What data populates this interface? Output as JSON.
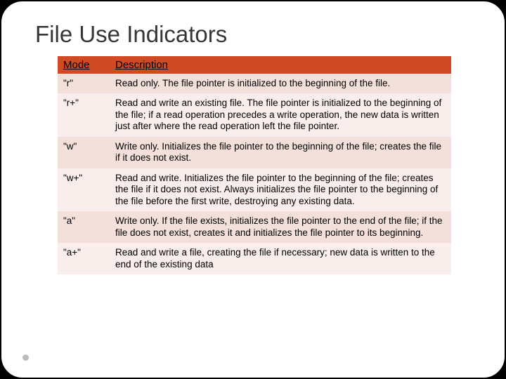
{
  "title": "File Use Indicators",
  "headers": {
    "mode": "Mode",
    "description": "Description"
  },
  "rows": [
    {
      "mode": "\"r\"",
      "desc": "Read only. The file pointer is initialized to the beginning of the file."
    },
    {
      "mode": "\"r+\"",
      "desc": "Read and write an existing file. The file pointer is initialized to the beginning of the file; if a read operation precedes a write operation, the new data is written just after where the read operation left the file pointer."
    },
    {
      "mode": "\"w\"",
      "desc": "Write only. Initializes the file pointer to the beginning of the file; creates the file if it does not exist."
    },
    {
      "mode": "\"w+\"",
      "desc": "Read and write. Initializes the file pointer to the beginning of the file; creates the file if it does not exist. Always initializes the file pointer to the beginning of the file before the first write, destroying any existing data."
    },
    {
      "mode": "\"a\"",
      "desc": "Write only. If the file exists, initializes the file pointer to the end of the file; if the file does not exist, creates it and initializes the file pointer to its beginning."
    },
    {
      "mode": "\"a+\"",
      "desc": "Read and write a file, creating the file if necessary; new data is written to the end of the existing data"
    }
  ]
}
